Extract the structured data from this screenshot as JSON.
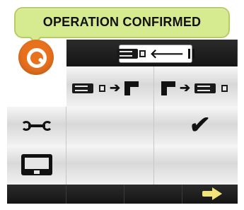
{
  "banner": {
    "text": "OPERATION CONFIRMED"
  },
  "icons": {
    "logo": "search-logo-icon",
    "usb_transfer_top": "usb-export-pause-icon",
    "usb_to_copy": "usb-to-copy-icon",
    "copy_to_usb": "copy-to-usb-icon",
    "tools": "wrench-icon",
    "confirm": "checkmark-icon",
    "monitor": "monitor-icon",
    "next": "next-arrow-icon"
  },
  "colors": {
    "banner_bg": "#d6ea90",
    "logo": "#e8711e",
    "next_arrow": "#f2e27a"
  }
}
